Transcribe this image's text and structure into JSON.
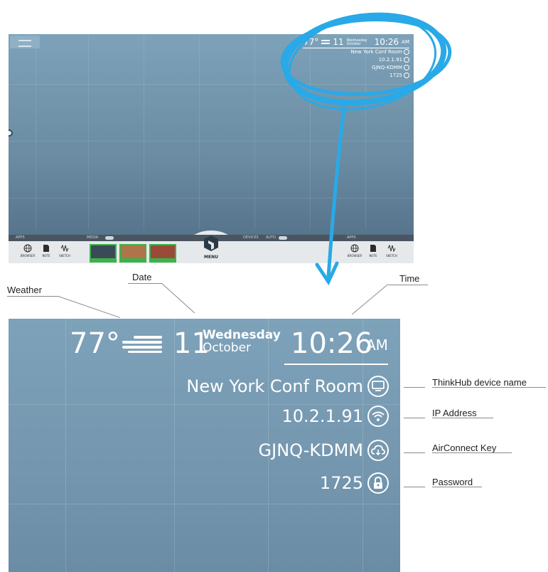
{
  "mini_status": {
    "temperature": "77°",
    "day": "11",
    "weekday": "Wednesday",
    "month": "October",
    "time": "10:26",
    "ampm": "AM",
    "device_name": "New York Conf Room",
    "ip_address": "10.2.1.91",
    "airconnect_key": "GJNQ-KDMM",
    "password": "1725"
  },
  "taskbar": {
    "apps_label_left": "APPS",
    "media_label": "MEDIA",
    "devices_label": "DEVICES",
    "auto_label": "AUTO",
    "apps_label_right": "APPS",
    "menu_label": "MENU",
    "apps": [
      {
        "label": "BROWSER",
        "icon": "globe-icon"
      },
      {
        "label": "NOTE",
        "icon": "note-icon"
      },
      {
        "label": "SKETCH",
        "icon": "sketch-icon"
      }
    ],
    "media_thumbs": 3
  },
  "zoom": {
    "temperature": "77°",
    "day": "11",
    "weekday": "Wednesday",
    "month": "October",
    "time": "10:26",
    "ampm": "AM",
    "device_name": "New York Conf Room",
    "ip_address": "10.2.1.91",
    "airconnect_key": "GJNQ-KDMM",
    "password": "1725"
  },
  "callouts": {
    "weather": "Weather",
    "date": "Date",
    "time": "Time",
    "device_name": "ThinkHub device name",
    "ip_address": "IP Address",
    "airconnect_key": "AirConnect Key",
    "password": "Password"
  },
  "colors": {
    "screen_blue": "#7da2b9",
    "highlight_circle": "#29a9e8",
    "media_green": "#3cb34a"
  }
}
